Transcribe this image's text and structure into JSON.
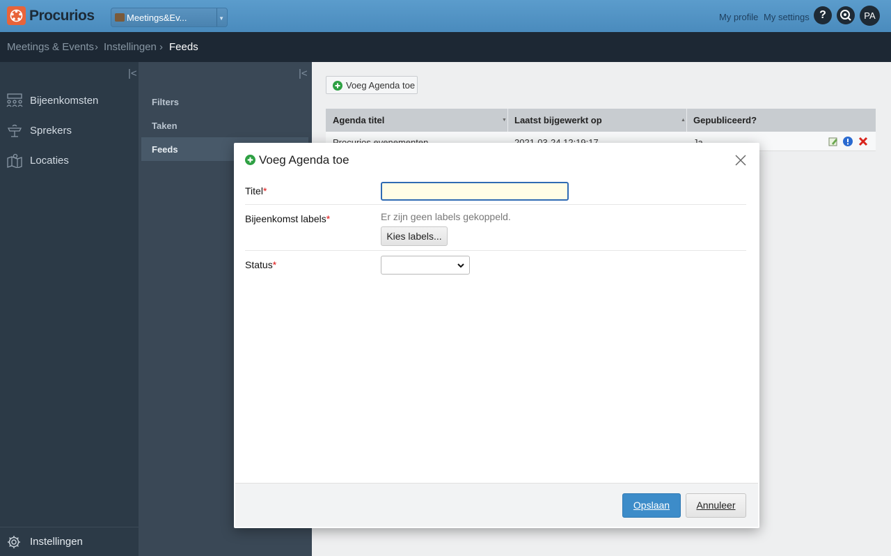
{
  "header": {
    "brand": "Procurios",
    "app_selector": "Meetings&Ev...",
    "my_profile": "My profile",
    "my_settings": "My settings",
    "help_icon": "?",
    "avatar": "PA"
  },
  "breadcrumb": [
    "Meetings & Events",
    "Instellingen",
    "Feeds"
  ],
  "sidebar": {
    "items": [
      {
        "label": "Bijeenkomsten",
        "icon": "people-icon"
      },
      {
        "label": "Sprekers",
        "icon": "lectern-icon"
      },
      {
        "label": "Locaties",
        "icon": "map-icon"
      }
    ],
    "bottom": {
      "label": "Instellingen",
      "icon": "gear-icon"
    }
  },
  "subnav": {
    "items": [
      "Filters",
      "Taken",
      "Feeds"
    ],
    "active": "Feeds"
  },
  "content": {
    "add_button": "Voeg Agenda toe",
    "table": {
      "headers": [
        "Agenda titel",
        "Laatst bijgewerkt op",
        "Gepubliceerd?"
      ],
      "rows": [
        {
          "title": "Procurios evenementen",
          "updated": "2021-03-24 12:19:17",
          "published": "Ja"
        }
      ]
    }
  },
  "modal": {
    "title": "Voeg Agenda toe",
    "fields": {
      "titel_label": "Titel",
      "labels_label": "Bijeenkomst labels",
      "no_labels": "Er zijn geen labels gekoppeld.",
      "kies_button": "Kies labels...",
      "status_label": "Status",
      "required_mark": "*"
    },
    "save_button": "Opslaan",
    "cancel_button": "Annuleer"
  },
  "colors": {
    "topbar": "#4a8bbd",
    "sidebar": "#2c3a47",
    "primary_button": "#3d8cc9",
    "accent_logo": "#e8643a"
  }
}
